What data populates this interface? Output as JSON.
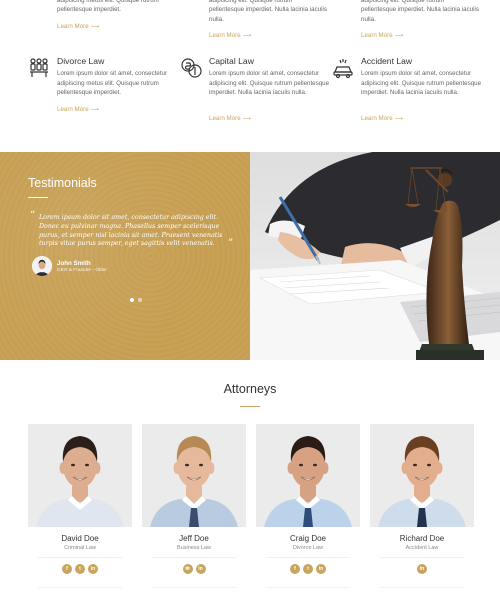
{
  "practice": {
    "top_columns": [
      {
        "text": "adipiscing metus elit. Quisque rutrum pellentesque imperdiet.",
        "learn_more": "Learn More"
      },
      {
        "text": "adipiscing elit. Quisque rutrum pellentesque imperdiet. Nulla lacinia iaculis nulla.",
        "learn_more": "Learn More"
      },
      {
        "text": "adipiscing elit. Quisque rutrum pellentesque imperdiet. Nulla lacinia iaculis nulla.",
        "learn_more": "Learn More"
      }
    ],
    "services": [
      {
        "title": "Divorce Law",
        "icon": "family-icon",
        "desc": "Lorem ipsum dolor sit amet, consectetur adipiscing metus elit. Quisque rutrum pellentesque imperdiet.",
        "learn_more": "Learn More"
      },
      {
        "title": "Capital Law",
        "icon": "money-icon",
        "desc": "Lorem ipsum dolor sit amet, consectetur adipiscing elit. Quisque rutrum pellentesque imperdiet. Nulla lacinia iaculis nulla.",
        "learn_more": "Learn More"
      },
      {
        "title": "Accident Law",
        "icon": "car-accident-icon",
        "desc": "Lorem ipsum dolor sit amet, consectetur adipiscing elit. Quisque rutrum pellentesque imperdiet. Nulla lacinia iaculis nulla.",
        "learn_more": "Learn More"
      }
    ],
    "arrow": "⟶"
  },
  "testimonials": {
    "title": "Testimonials",
    "quote": "Lorem ipsum dolor sit amet, consectetur adipiscing elit. Donec eu pulvinar magna. Phasellus semper scelerisque purus, et semper nisl lacinia sit amet. Praesent venenatis turpis vitae purus semper, eget sagittis velit venenatis.",
    "open_mark": "“",
    "close_mark": "”",
    "author_name": "John Smith",
    "author_role": "CEO & Founder - Okler",
    "slides": 2,
    "active_slide": 1,
    "accent_color": "#c9a155"
  },
  "attorneys": {
    "title": "Attorneys",
    "people": [
      {
        "name": "David Doe",
        "role": "Criminal Law",
        "social": [
          "f",
          "t",
          "in"
        ],
        "skin": "#dcae8f",
        "hair": "#2b2019",
        "shirt": "#dfe6ef",
        "tie": ""
      },
      {
        "name": "Jeff Doe",
        "role": "Business Law",
        "social": [
          "mail",
          "in"
        ],
        "skin": "#e6b99c",
        "hair": "#b78a55",
        "shirt": "#b9cbe0",
        "tie": "#3b4d6e"
      },
      {
        "name": "Craig Doe",
        "role": "Divorce Law",
        "social": [
          "f",
          "t",
          "in"
        ],
        "skin": "#d6a283",
        "hair": "#2a1c15",
        "shirt": "#bcd2ea",
        "tie": "#2e4b7a"
      },
      {
        "name": "Richard Doe",
        "role": "Accident Law",
        "social": [
          "in"
        ],
        "skin": "#e2ae8d",
        "hair": "#6b3f22",
        "shirt": "#cfdcec",
        "tie": "#24324f"
      }
    ]
  },
  "brand_color": "#c9a45c"
}
